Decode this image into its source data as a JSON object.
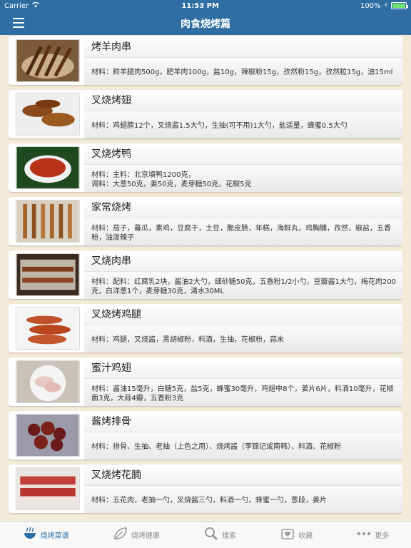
{
  "status": {
    "carrier": "Carrier",
    "time": "11:53 PM",
    "battery": "100%"
  },
  "nav": {
    "title": "肉食烧烤篇"
  },
  "recipes": [
    {
      "title": "烤羊肉串",
      "desc": "材料：鲜羊腿肉500g，肥羊肉100g，盐10g，辣椒粉15g，孜然粉15g，孜然粒15g，油15ml"
    },
    {
      "title": "叉烧烤翅",
      "desc": "材料：鸡翅膀12个，叉烧酱1.5大勺，生抽(可不用)1大勺，盐适量，蜂蜜0.5大勺"
    },
    {
      "title": "叉烧烤鸭",
      "desc": "材料：主料：北京填鸭1200克，\n调料：大葱50克，姜50克，麦芽糖50克，花椒5克"
    },
    {
      "title": "家常烧烤",
      "desc": "材料：茄子，蕃瓜，素鸡，豆腐干，土豆，脆皮肠，年糕，海鲜丸，鸡胸脯，孜然，椒盐，五香粉，油泼辣子"
    },
    {
      "title": "叉烧肉串",
      "desc": "材料：配料：红腐乳2块，酱油2大勺，细砂糖50克，五香粉1/2小勺，豆瓣酱1大勺，梅花肉200克，白洋葱1个，麦芽糖30克，清水30ML"
    },
    {
      "title": "叉烧烤鸡腿",
      "desc": "材料：鸡腿，叉烧酱，黑胡椒粉，料酒，生抽，花椒粉，蒜末"
    },
    {
      "title": "蜜汁鸡翅",
      "desc": "材料：酱油15毫升，白糖5克，盐5克，蜂蜜30毫升，鸡翅中8个，姜片6片，料酒10毫升，花椒面3克，大蒜4瓣，五香粉3克"
    },
    {
      "title": "酱烤排骨",
      "desc": "材料：排骨、生抽、老抽（上色之用）、烧烤酱（李锦记或南韩）、料酒、花椒粉"
    },
    {
      "title": "叉烧烤花腩",
      "desc": "材料：五花肉，老抽一勺，叉烧酱三勺，料酒一勺，蜂蜜一勺，葱段，姜片"
    }
  ],
  "tabs": [
    {
      "label": "烧烤菜谱",
      "icon": "grill-icon"
    },
    {
      "label": "烧烤健康",
      "icon": "leaf-icon"
    },
    {
      "label": "搜索",
      "icon": "search-icon"
    },
    {
      "label": "收藏",
      "icon": "favorite-icon"
    },
    {
      "label": "更多",
      "icon": "more-icon"
    }
  ],
  "colors": {
    "accent": "#2e6ea3",
    "background": "#f3ead8"
  }
}
